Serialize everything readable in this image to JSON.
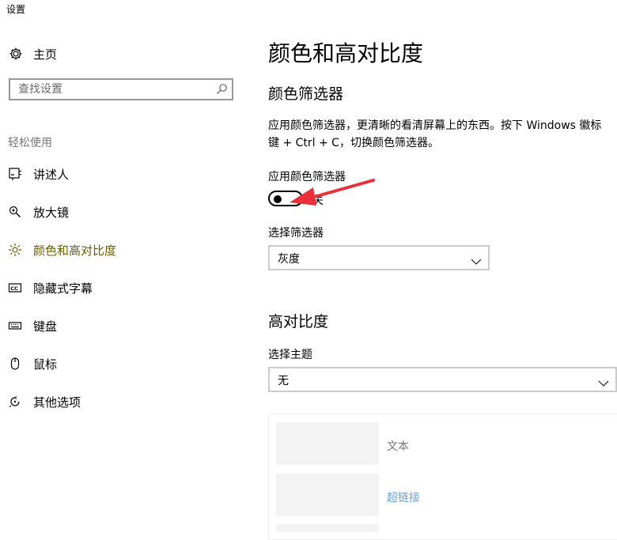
{
  "window": {
    "title": "设置"
  },
  "sidebar": {
    "home_label": "主页",
    "search_placeholder": "查找设置",
    "group_label": "轻松使用",
    "items": [
      {
        "label": "讲述人",
        "icon": "narrator-icon"
      },
      {
        "label": "放大镜",
        "icon": "magnifier-icon"
      },
      {
        "label": "颜色和高对比度",
        "icon": "brightness-icon",
        "active": true
      },
      {
        "label": "隐藏式字幕",
        "icon": "closed-captions-icon"
      },
      {
        "label": "键盘",
        "icon": "keyboard-icon"
      },
      {
        "label": "鼠标",
        "icon": "mouse-icon"
      },
      {
        "label": "其他选项",
        "icon": "other-options-icon"
      }
    ]
  },
  "main": {
    "title": "颜色和高对比度",
    "color_filter": {
      "heading": "颜色筛选器",
      "desc_line1": "应用颜色筛选器，更清晰的看清屏幕上的东西。按下 Windows 徽标",
      "desc_line2": "键 + Ctrl + C，切换颜色筛选器。",
      "toggle_label": "应用颜色筛选器",
      "toggle_state": "关",
      "select_label": "选择筛选器",
      "select_value": "灰度"
    },
    "high_contrast": {
      "heading": "高对比度",
      "theme_label": "选择主题",
      "theme_value": "无",
      "preview_text": "文本",
      "preview_link": "超链接"
    }
  },
  "colors": {
    "active_nav": "#6b5e00",
    "link": "#6aa2d8",
    "annotation_arrow": "#e8313a"
  }
}
